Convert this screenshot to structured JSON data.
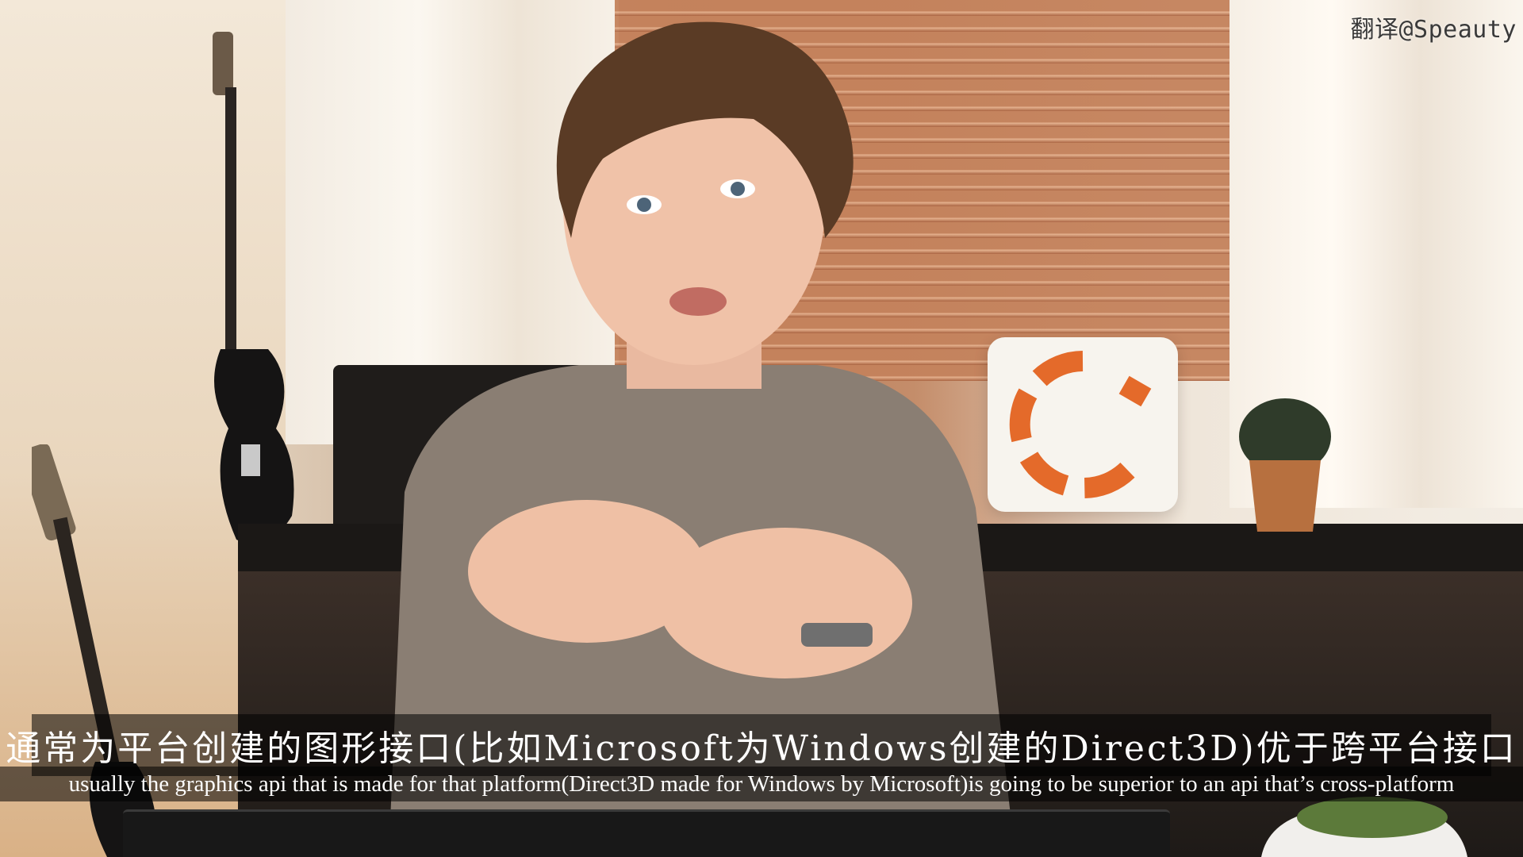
{
  "watermark": "翻译@Speauty",
  "subtitles": {
    "chinese": "通常为平台创建的图形接口(比如Microsoft为Windows创建的Direct3D)优于跨平台接口",
    "english": "usually the graphics api that is made for that platform(Direct3D made for Windows by Microsoft)is going to be superior to an api that’s cross-platform"
  },
  "colors": {
    "pillow_logo": "#e46a2a",
    "subtitle_text": "#ffffff",
    "subtitle_background": "#000000"
  }
}
